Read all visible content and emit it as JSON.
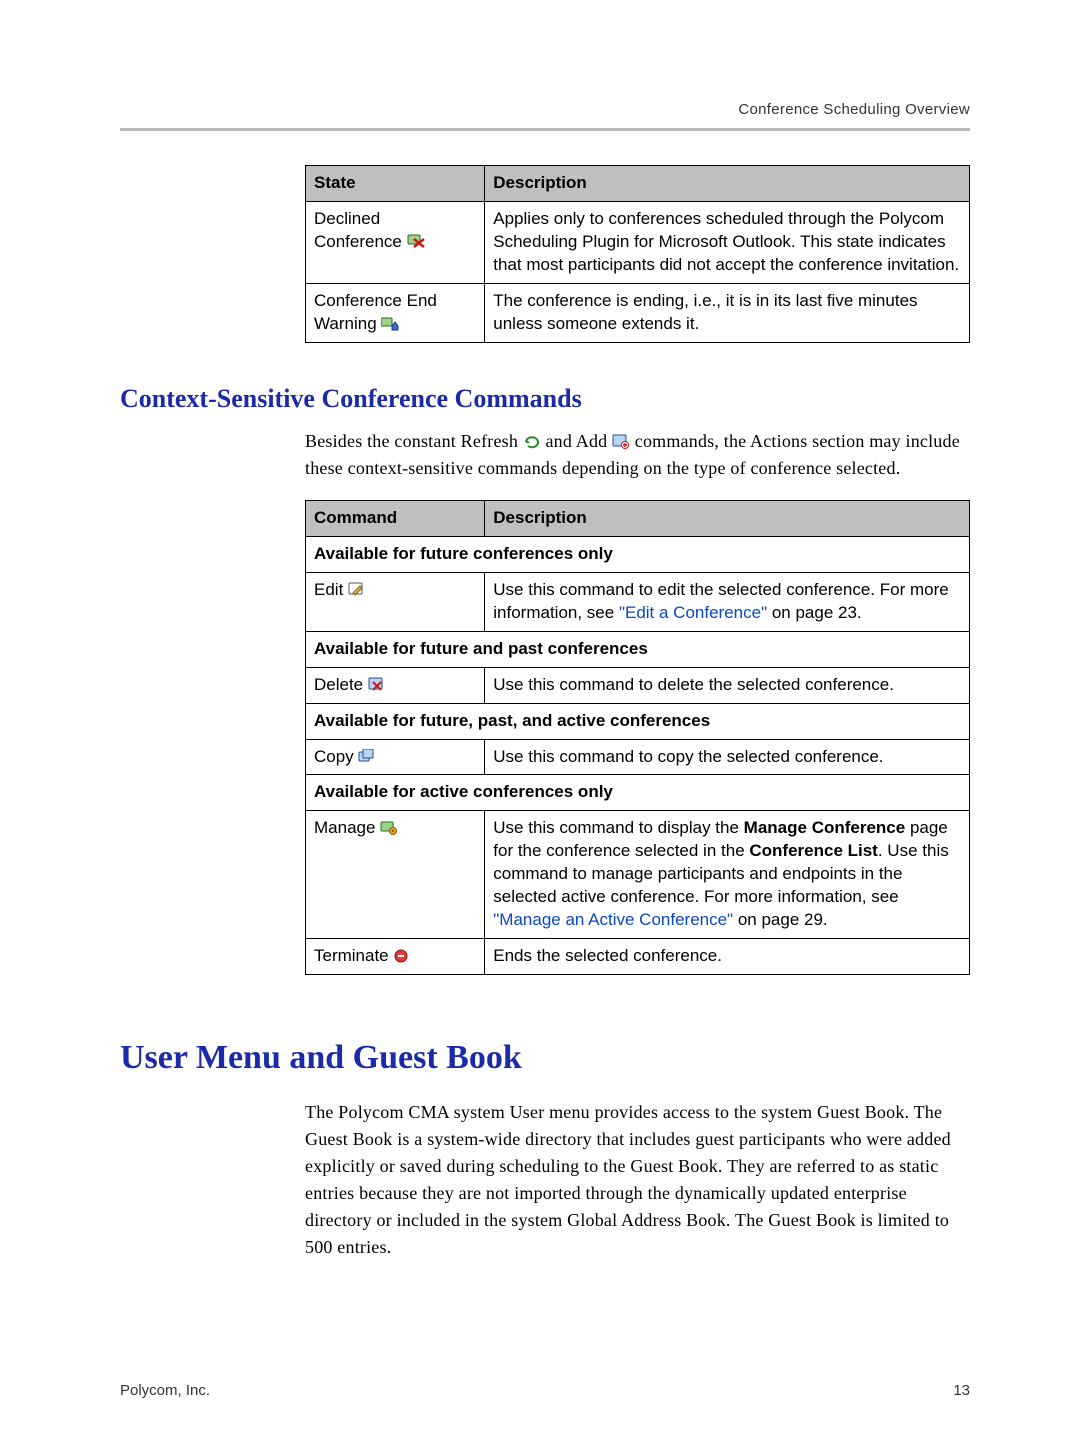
{
  "header_right": "Conference Scheduling Overview",
  "table1": {
    "head": {
      "c1": "State",
      "c2": "Description"
    },
    "rows": [
      {
        "c1a": "Declined",
        "c1b": "Conference",
        "icon": "declined-conference-icon",
        "c2": "Applies only to conferences scheduled through the Polycom Scheduling Plugin for Microsoft Outlook. This state indicates that most participants did not accept the conference invitation."
      },
      {
        "c1a": "Conference End",
        "c1b": "Warning",
        "icon": "conference-end-warning-icon",
        "c2": "The conference is ending, i.e., it is in its last five minutes unless someone extends it."
      }
    ]
  },
  "h2_context": "Context-Sensitive Conference Commands",
  "context_para": {
    "pre": "Besides the constant Refresh ",
    "mid": " and Add ",
    "post": " commands, the Actions section may include these context-sensitive commands depending on the type of conference selected."
  },
  "table2": {
    "head": {
      "c1": "Command",
      "c2": "Description"
    },
    "sections": {
      "s1": "Available for future conferences only",
      "s2": "Available for future and past conferences",
      "s3": "Available for future, past, and active conferences",
      "s4": "Available for active conferences only"
    },
    "edit": {
      "label": "Edit",
      "desc_pre": "Use this command to edit the selected conference. For more information, see ",
      "link": "\"Edit a Conference\"",
      "desc_post": " on page 23."
    },
    "delete": {
      "label": "Delete",
      "desc": "Use this command to delete the selected conference."
    },
    "copy": {
      "label": "Copy",
      "desc": "Use this command to copy the selected conference."
    },
    "manage": {
      "label": "Manage",
      "desc_a": "Use this command to display the ",
      "bold_a": "Manage Conference",
      "desc_b": " page for the conference selected in the ",
      "bold_b": "Conference List",
      "desc_c": ". Use this command to manage participants and endpoints in the selected active conference. For more information, see ",
      "link": "\"Manage an Active Conference\"",
      "desc_d": " on page 29."
    },
    "terminate": {
      "label": "Terminate",
      "desc": "Ends the selected conference."
    }
  },
  "h1_user": "User Menu and Guest Book",
  "user_para": "The Polycom CMA system User menu provides access to the system Guest Book. The Guest Book is a system-wide directory that includes guest participants who were added explicitly or saved during scheduling to the Guest Book. They are referred to as static entries because they are not imported through the dynamically updated enterprise directory or included in the system Global Address Book. The Guest Book is limited to 500 entries.",
  "footer_left": "Polycom, Inc.",
  "footer_right": "13"
}
